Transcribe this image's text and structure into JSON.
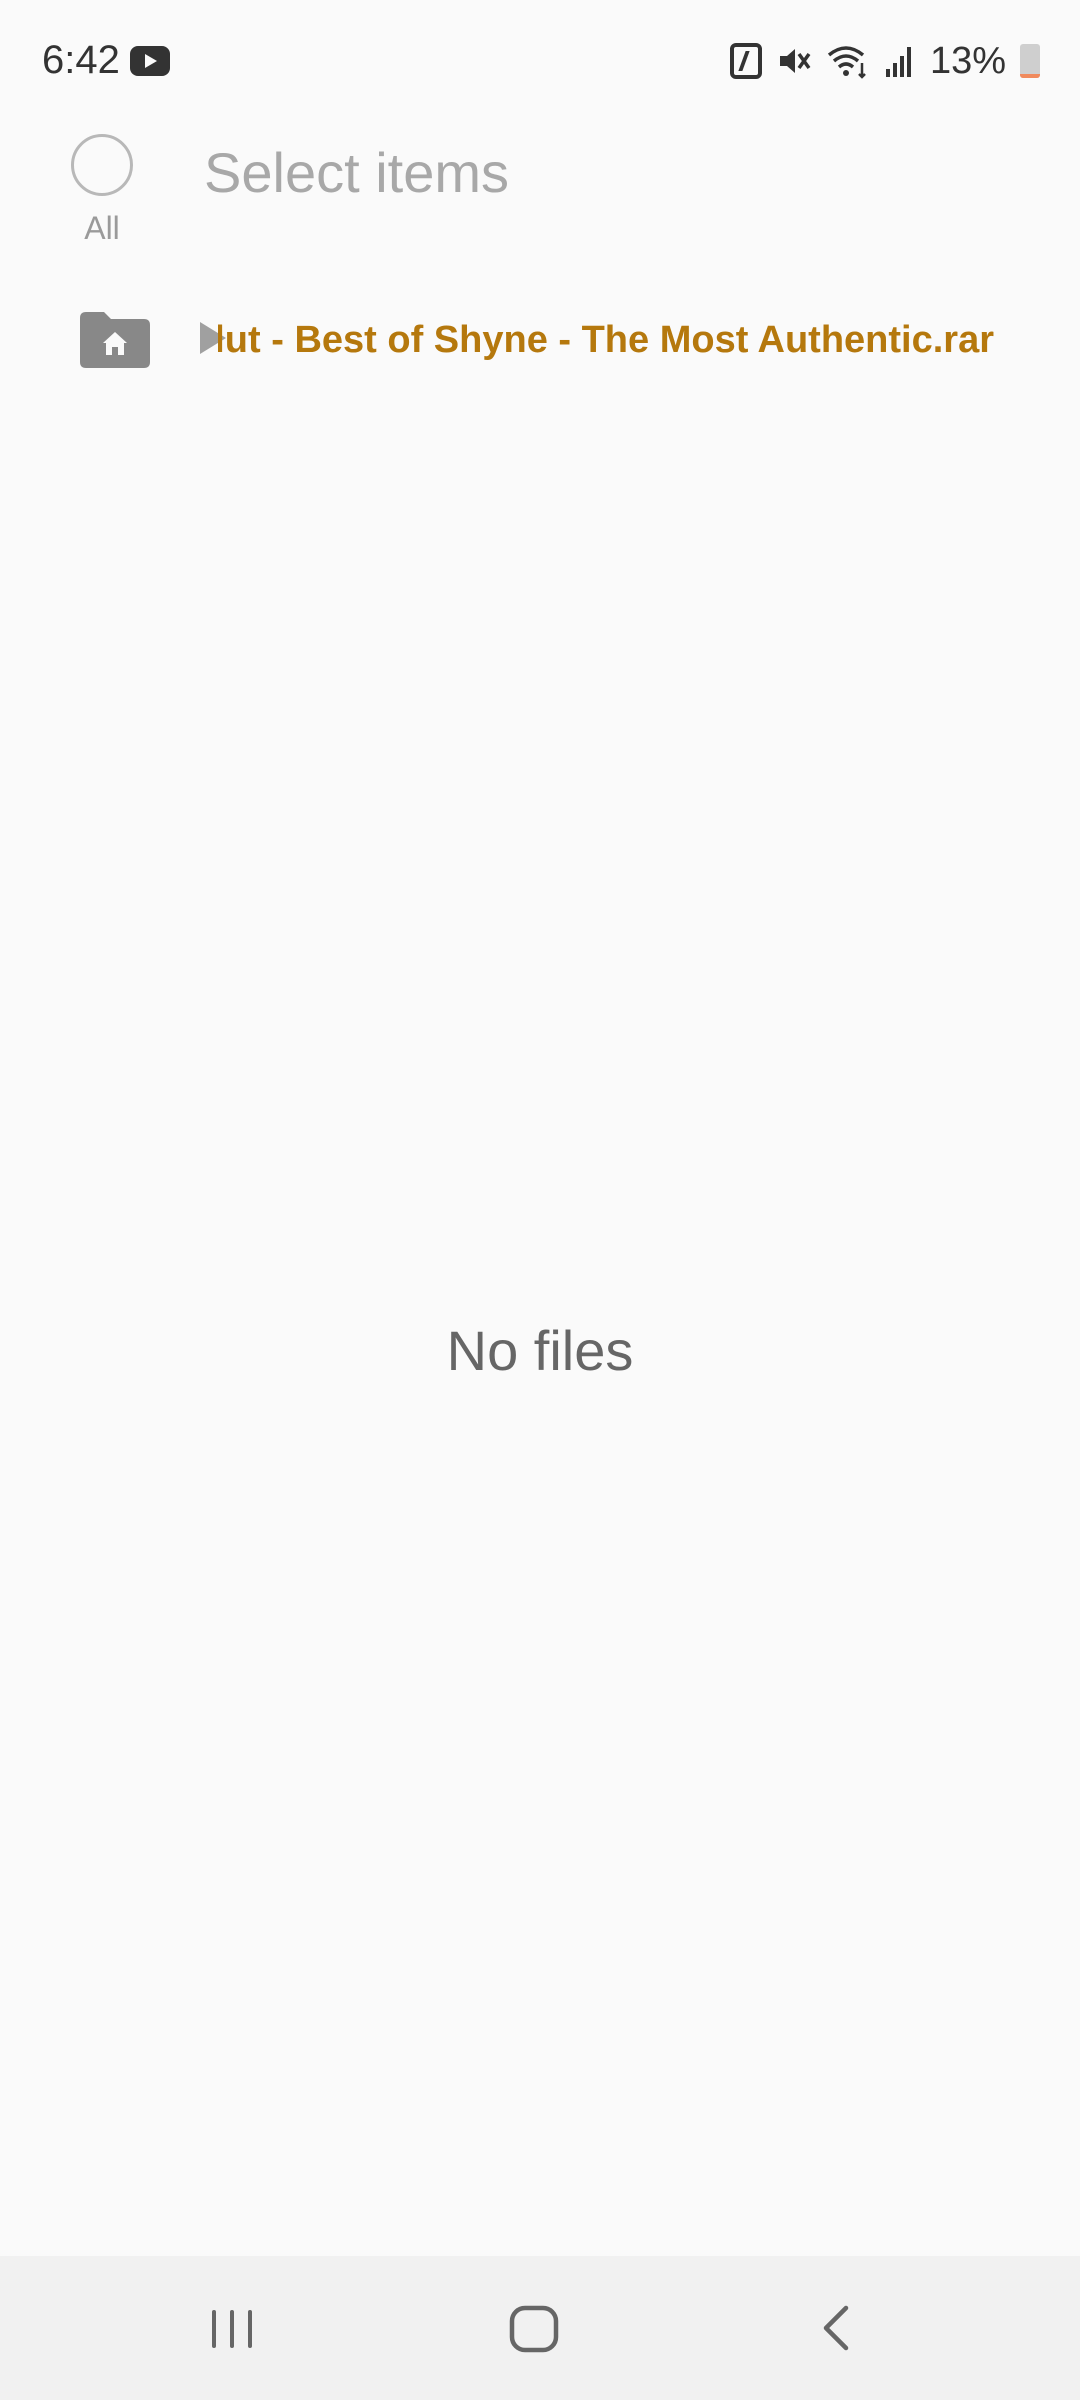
{
  "status_bar": {
    "time": "6:42",
    "battery_percent": "13%",
    "battery_level": 0.13,
    "icons": [
      "youtube-icon",
      "nfc-icon",
      "mute-icon",
      "wifi-icon",
      "signal-icon",
      "battery-icon"
    ]
  },
  "header": {
    "select_all_label": "All",
    "title": "Select items"
  },
  "breadcrumb": {
    "home_icon": "home-folder-icon",
    "path_text": "Heltah Skeltah Volut - Best of Shyne - The Most Authentic.rar"
  },
  "main": {
    "empty_message": "No files"
  },
  "nav_bar": {
    "buttons": [
      "recents",
      "home",
      "back"
    ]
  },
  "colors": {
    "background": "#fafafa",
    "breadcrumb_accent": "#b5780d",
    "nav_background": "#f1f1f1",
    "battery_low": "#f08a5d"
  }
}
